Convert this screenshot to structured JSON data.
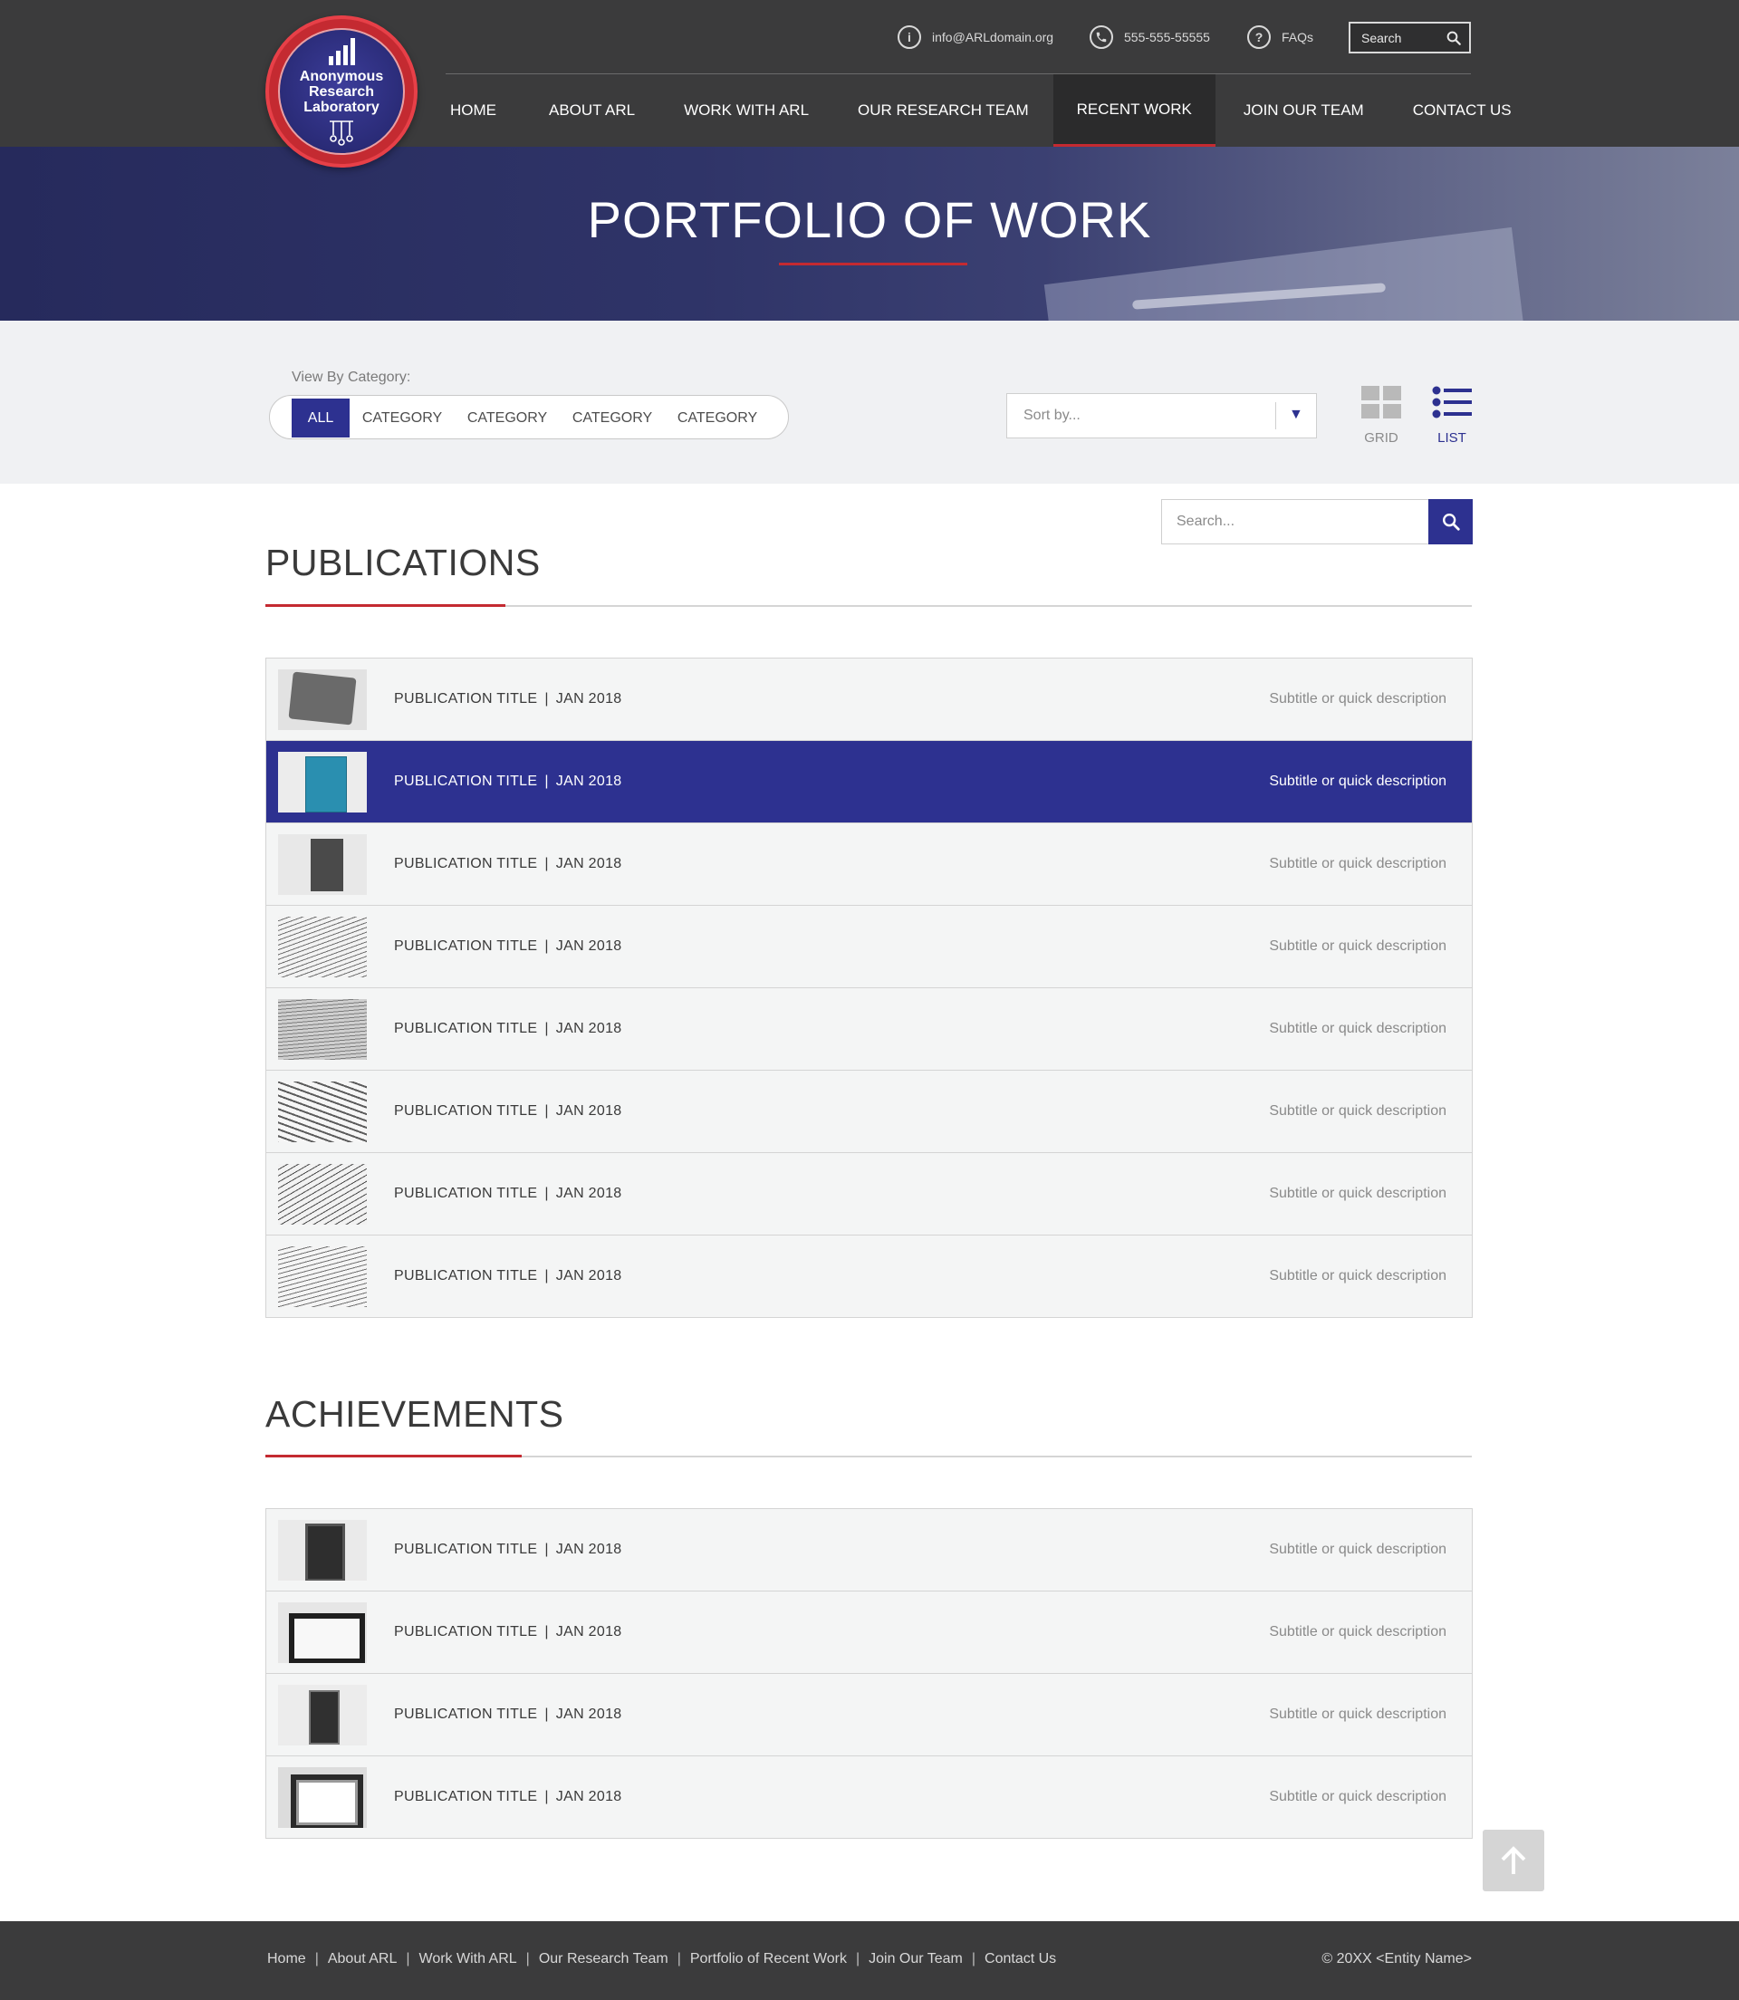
{
  "logo": {
    "line1": "Anonymous",
    "line2": "Research",
    "line3": "Laboratory"
  },
  "utility": {
    "email": "info@ARLdomain.org",
    "phone": "555-555-55555",
    "faqs": "FAQs",
    "search_placeholder": "Search"
  },
  "nav": {
    "items": [
      {
        "label": "HOME"
      },
      {
        "label": "ABOUT ARL"
      },
      {
        "label": "WORK WITH ARL"
      },
      {
        "label": "OUR RESEARCH TEAM"
      },
      {
        "label": "RECENT WORK"
      },
      {
        "label": "JOIN OUR TEAM"
      },
      {
        "label": "CONTACT US"
      }
    ],
    "active": "RECENT WORK"
  },
  "hero": {
    "title": "PORTFOLIO OF WORK"
  },
  "filters": {
    "label": "View By Category:",
    "categories": [
      "ALL",
      "CATEGORY",
      "CATEGORY",
      "CATEGORY",
      "CATEGORY"
    ],
    "active": "ALL",
    "sort_placeholder": "Sort by...",
    "view_grid": "GRID",
    "view_list": "LIST",
    "active_view": "LIST"
  },
  "publications": {
    "heading": "PUBLICATIONS",
    "search_placeholder": "Search...",
    "items": [
      {
        "title": "PUBLICATION TITLE",
        "date": "JAN 2018",
        "desc": "Subtitle or quick description"
      },
      {
        "title": "PUBLICATION TITLE",
        "date": "JAN 2018",
        "desc": "Subtitle or quick description"
      },
      {
        "title": "PUBLICATION TITLE",
        "date": "JAN 2018",
        "desc": "Subtitle or quick description"
      },
      {
        "title": "PUBLICATION TITLE",
        "date": "JAN 2018",
        "desc": "Subtitle or quick description"
      },
      {
        "title": "PUBLICATION TITLE",
        "date": "JAN 2018",
        "desc": "Subtitle or quick description"
      },
      {
        "title": "PUBLICATION TITLE",
        "date": "JAN 2018",
        "desc": "Subtitle or quick description"
      },
      {
        "title": "PUBLICATION TITLE",
        "date": "JAN 2018",
        "desc": "Subtitle or quick description"
      },
      {
        "title": "PUBLICATION TITLE",
        "date": "JAN 2018",
        "desc": "Subtitle or quick description"
      }
    ]
  },
  "achievements": {
    "heading": "ACHIEVEMENTS",
    "items": [
      {
        "title": "PUBLICATION TITLE",
        "date": "JAN 2018",
        "desc": "Subtitle or quick description"
      },
      {
        "title": "PUBLICATION TITLE",
        "date": "JAN 2018",
        "desc": "Subtitle or quick description"
      },
      {
        "title": "PUBLICATION TITLE",
        "date": "JAN 2018",
        "desc": "Subtitle or quick description"
      },
      {
        "title": "PUBLICATION TITLE",
        "date": "JAN 2018",
        "desc": "Subtitle or quick description"
      }
    ]
  },
  "footer": {
    "links": [
      "Home",
      "About ARL",
      "Work With ARL",
      "Our Research Team",
      "Portfolio of Recent Work",
      "Join Our Team",
      "Contact Us"
    ],
    "copyright": "© 20XX <Entity Name>"
  },
  "colors": {
    "primary": "#2d3190",
    "accent": "#c42a31",
    "header_bg": "#3b3b3c",
    "row_bg": "#f4f5f5",
    "filter_bg": "#f0f1f3"
  },
  "icons": {
    "email": "info-icon",
    "phone": "phone-icon",
    "faqs": "question-icon",
    "search": "search-icon",
    "grid": "grid-icon",
    "list": "list-icon",
    "back_to_top": "arrow-up-icon"
  }
}
